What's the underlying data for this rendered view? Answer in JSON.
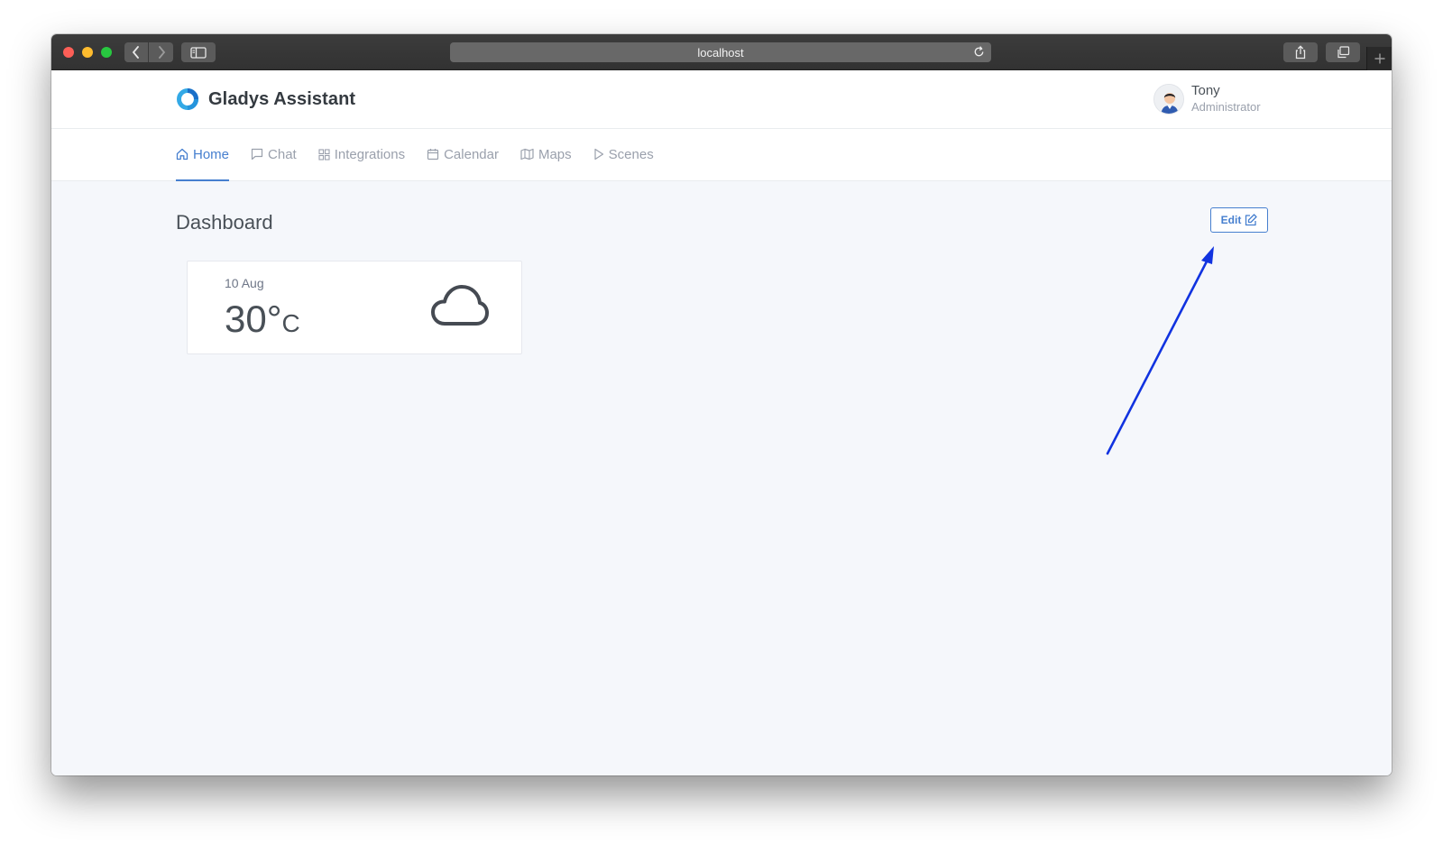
{
  "browser": {
    "url": "localhost",
    "controls": [
      "close-button",
      "minimize-button",
      "zoom-button",
      "back",
      "forward",
      "sidebar",
      "reload",
      "share",
      "tabs",
      "new-tab"
    ]
  },
  "app": {
    "name": "Gladys Assistant",
    "accent_color": "#467fcf"
  },
  "user": {
    "name": "Tony",
    "role": "Administrator"
  },
  "nav": {
    "items": [
      {
        "label": "Home",
        "icon": "home-icon",
        "active": true
      },
      {
        "label": "Chat",
        "icon": "chat-icon",
        "active": false
      },
      {
        "label": "Integrations",
        "icon": "grid-icon",
        "active": false
      },
      {
        "label": "Calendar",
        "icon": "calendar-icon",
        "active": false
      },
      {
        "label": "Maps",
        "icon": "map-icon",
        "active": false
      },
      {
        "label": "Scenes",
        "icon": "play-icon",
        "active": false
      }
    ]
  },
  "dashboard": {
    "title": "Dashboard",
    "edit_label": "Edit",
    "weather": {
      "date": "10 Aug",
      "temperature": "30°",
      "unit": "C",
      "icon": "cloud-icon"
    }
  },
  "annotation": {
    "arrow_color": "#1133e0",
    "points_to": "edit-button"
  }
}
